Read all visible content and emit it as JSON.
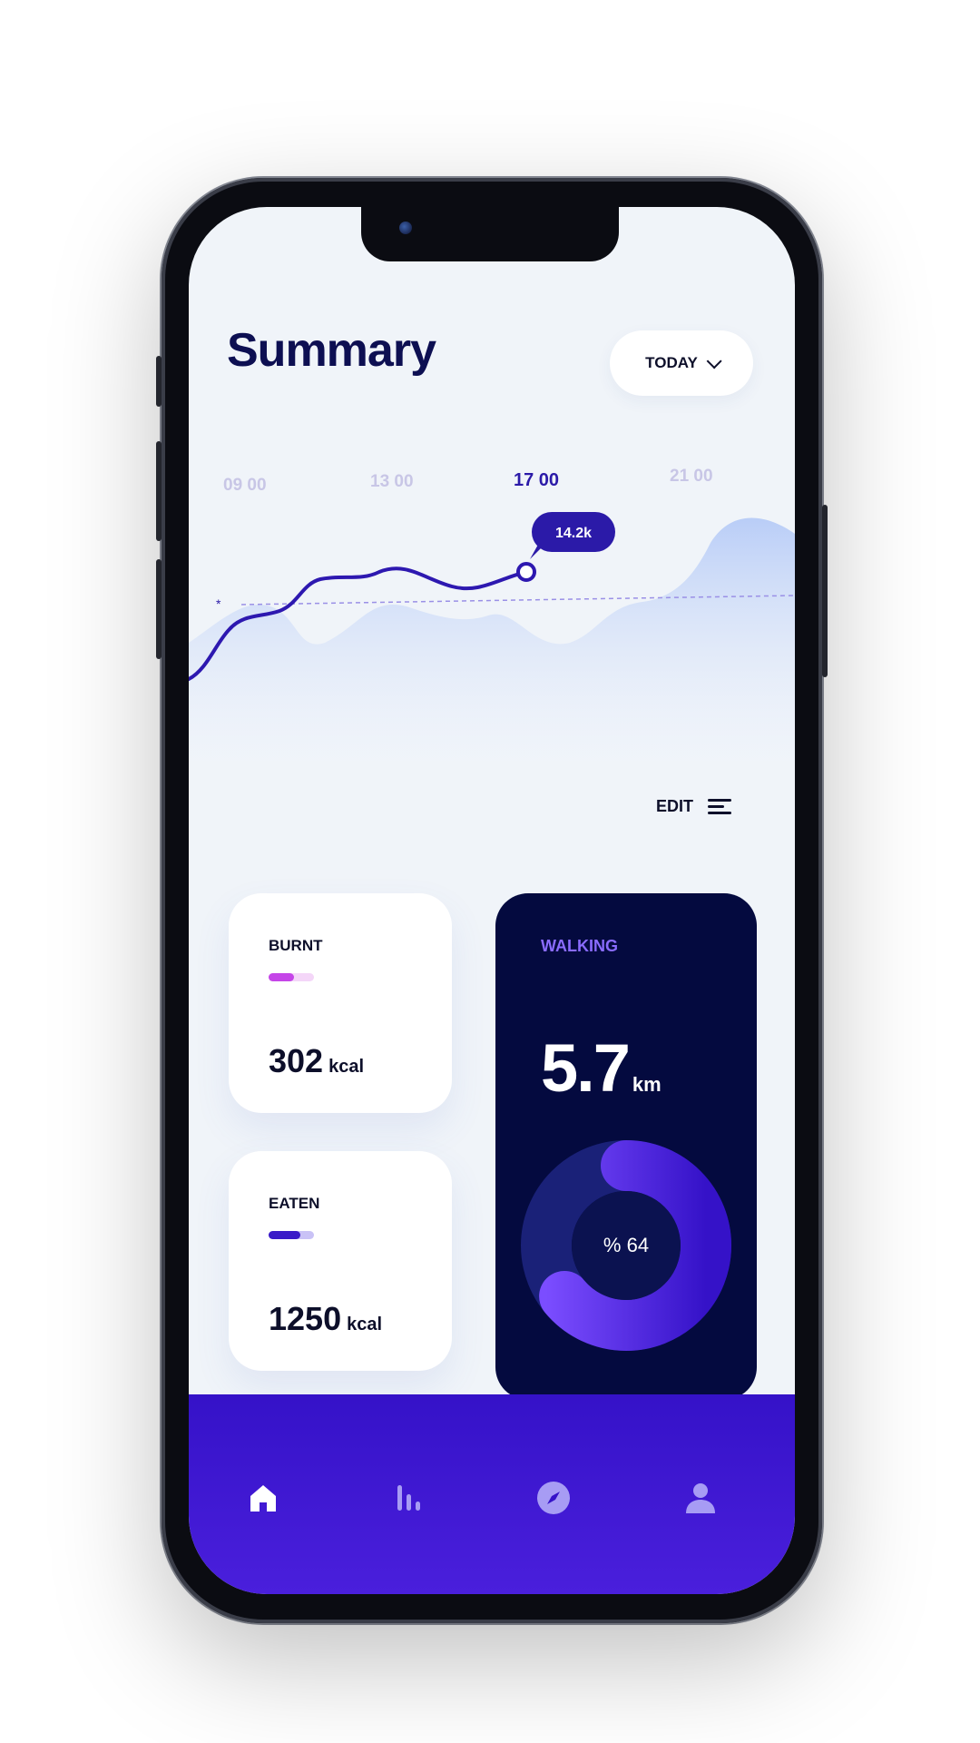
{
  "header": {
    "title": "Summary",
    "period_label": "TODAY"
  },
  "timeline": {
    "labels": [
      "09 00",
      "13 00",
      "17 00",
      "21 00"
    ],
    "active_index": 2
  },
  "chart": {
    "tooltip_value": "14.2k",
    "baseline_marker": "*"
  },
  "edit": {
    "label": "EDIT"
  },
  "cards": {
    "burnt": {
      "label": "BURNT",
      "value": "302",
      "unit": "kcal",
      "progress": 0.55,
      "color": "#c545e8"
    },
    "eaten": {
      "label": "EATEN",
      "value": "1250",
      "unit": "kcal",
      "progress": 0.7,
      "color": "#3a1ac8"
    }
  },
  "walking": {
    "label": "WALKING",
    "distance": "5.7",
    "unit": "km",
    "percent_label": "% 64",
    "percent": 64
  },
  "nav": {
    "items": [
      "home-icon",
      "stats-icon",
      "compass-icon",
      "profile-icon"
    ],
    "active": "home-icon"
  },
  "colors": {
    "primary": "#2b1aa8",
    "dark_card": "#040a3f",
    "accent": "#7b4dff",
    "nav": "#3512c8"
  }
}
